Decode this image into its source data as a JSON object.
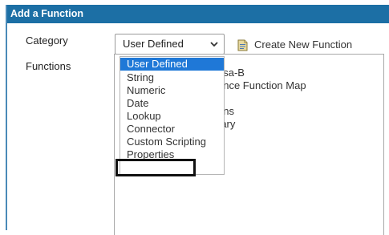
{
  "dialog": {
    "title": "Add a Function",
    "category_label": "Category",
    "functions_label": "Functions",
    "category_select": {
      "value": "User Defined",
      "chevron_icon": "chevron-down-icon"
    },
    "create_new": {
      "label": "Create New Function",
      "icon": "document-icon"
    },
    "function_list_items": [
      "asa-B",
      "ence Function Map",
      "ons",
      "rary"
    ],
    "dropdown_options": [
      "User Defined",
      "String",
      "Numeric",
      "Date",
      "Lookup",
      "Connector",
      "Custom Scripting",
      "Properties"
    ],
    "selected_option": "User Defined",
    "highlighted_option": "Properties"
  },
  "colors": {
    "titlebar": "#1c6fa5",
    "selected_option_bg": "#1f78d7"
  }
}
